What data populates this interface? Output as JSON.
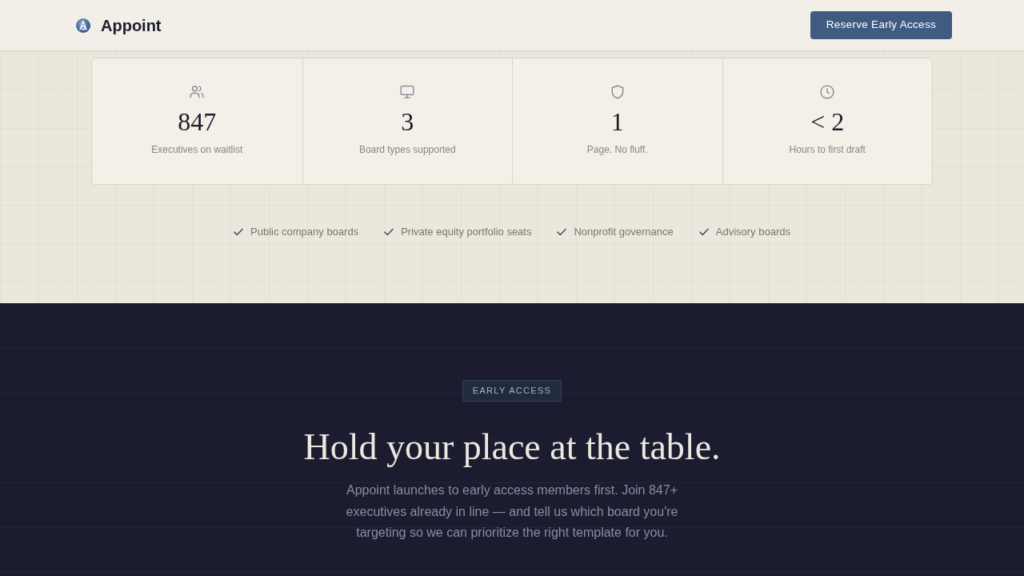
{
  "header": {
    "brand": "Appoint",
    "cta": "Reserve Early Access"
  },
  "stats": [
    {
      "kind": "people",
      "value": "847",
      "label": "Executives on waitlist"
    },
    {
      "kind": "monitor",
      "value": "3",
      "label": "Board types supported"
    },
    {
      "kind": "shield",
      "value": "1",
      "label": "Page. No fluff."
    },
    {
      "kind": "clock",
      "value": "< 2",
      "label": "Hours to first draft"
    }
  ],
  "features": [
    "Public company boards",
    "Private equity portfolio seats",
    "Nonprofit governance",
    "Advisory boards"
  ],
  "early_access": {
    "badge": "EARLY ACCESS",
    "heading": "Hold your place at the table.",
    "body": "Appoint launches to early access members first. Join 847+ executives already in line — and tell us which board you're targeting so we can prioritize the right template for you."
  }
}
